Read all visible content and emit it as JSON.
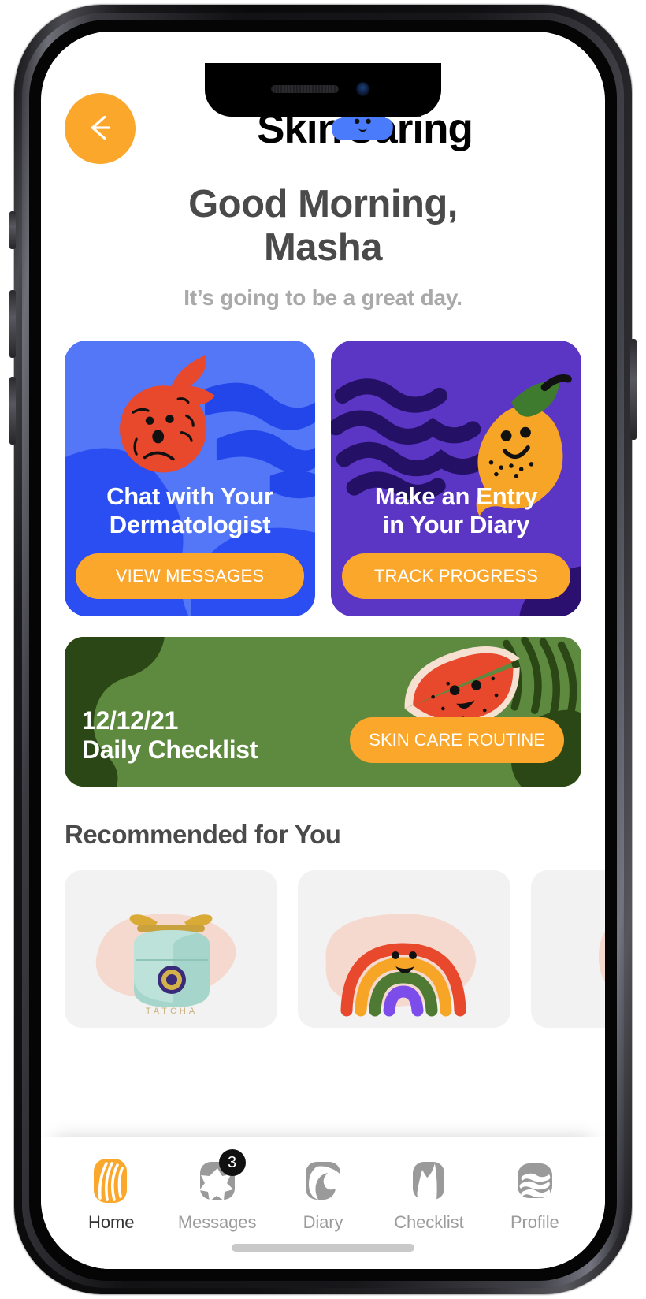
{
  "brand": {
    "word_left": "Skin",
    "word_right": "Caring",
    "sun_icon": "sun-icon",
    "cloud_icon": "smiling-cloud-icon"
  },
  "header": {
    "back_icon": "arrow-left-icon",
    "greeting": "Good Morning, Masha",
    "greeting_line1": "Good Morning,",
    "greeting_line2": "Masha",
    "subgreeting": "It’s going to be a great day."
  },
  "feature_cards": [
    {
      "title_line1": "Chat with Your",
      "title_line2": "Dermatologist",
      "button_label": "VIEW MESSAGES",
      "bg_color": "#2B4EF2",
      "art": "sad-orange-character"
    },
    {
      "title_line1": "Make an Entry",
      "title_line2": "in Your Diary",
      "button_label": "TRACK PROGRESS",
      "bg_color": "#5B35C4",
      "art": "smiling-mango-character"
    }
  ],
  "checklist": {
    "date": "12/12/21",
    "label": "Daily Checklist",
    "button_label": "SKIN CARE ROUTINE",
    "bg_color": "#5D8A3F",
    "art": "smiling-watermelon-character"
  },
  "recommended": {
    "title": "Recommended for You",
    "items": [
      {
        "art": "skincare-jar-product",
        "label": "TATCHA"
      },
      {
        "art": "smiling-rainbow-illustration",
        "label": ""
      },
      {
        "art": "product-partial",
        "label": ""
      }
    ]
  },
  "tabbar": {
    "items": [
      {
        "label": "Home",
        "icon": "home-waves-icon",
        "active": true,
        "badge": ""
      },
      {
        "label": "Messages",
        "icon": "star-chat-icon",
        "active": false,
        "badge": "3"
      },
      {
        "label": "Diary",
        "icon": "diary-swirl-icon",
        "active": false,
        "badge": ""
      },
      {
        "label": "Checklist",
        "icon": "checklist-leaf-icon",
        "active": false,
        "badge": ""
      },
      {
        "label": "Profile",
        "icon": "profile-waves-icon",
        "active": false,
        "badge": ""
      }
    ]
  },
  "colors": {
    "accent_orange": "#FBA72B",
    "blue_card": "#2B4EF2",
    "purple_card": "#5B35C4",
    "green_card": "#5D8A3F",
    "text_dark": "#4a4a4a",
    "text_muted": "#a9a9a9"
  }
}
